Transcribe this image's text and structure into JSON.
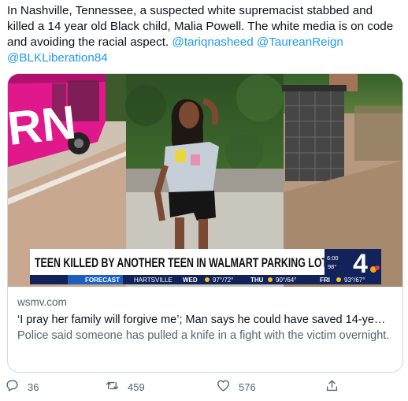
{
  "tweet": {
    "text": "In Nashville, Tennessee, a suspected white supremacist stabbed and killed a 14 year old Black child, Malia Powell. The white media is on code and avoiding the racial aspect.",
    "mentions": [
      "@tariqnasheed",
      "@TaureanReign",
      "@BLKLiberation84"
    ]
  },
  "card": {
    "domain": "wsmv.com",
    "title": "‘I pray her family will forgive me’; Man says he could have saved 14-ye…",
    "description": "Police said someone has pulled a knife in a fight with the victim overnight.",
    "media": {
      "headline": "TEEN KILLED BY ANOTHER TEEN IN WALMART PARKING LOT",
      "time": "6:00",
      "temp": "98°",
      "channel_number": "4",
      "bus_text": "RN",
      "ticker": {
        "label": "FORECAST",
        "city": "HARTSVILLE",
        "days": [
          {
            "day": "WED",
            "temps": "97°/72°"
          },
          {
            "day": "THU",
            "temps": "90°/64°"
          },
          {
            "day": "FRI",
            "temps": "93°/67°"
          }
        ]
      }
    }
  },
  "actions": {
    "replies": "36",
    "retweets": "459",
    "likes": "576"
  },
  "colors": {
    "accent": "#1d9bf0",
    "secondary_text": "#536471",
    "banner_navy": "#11235a"
  }
}
